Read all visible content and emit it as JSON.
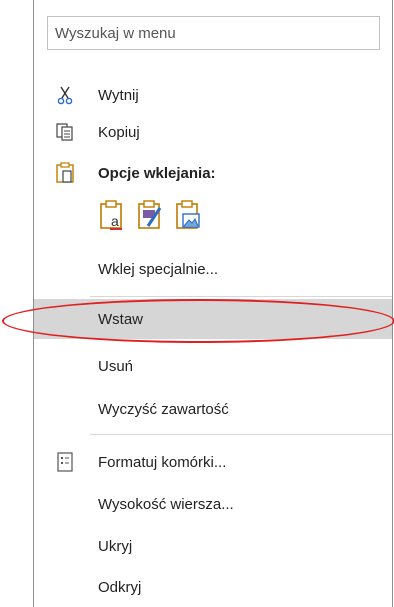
{
  "search": {
    "placeholder": "Wyszukaj w menu"
  },
  "items": {
    "cut": "Wytnij",
    "copy": "Kopiuj",
    "paste_options": "Opcje wklejania:",
    "paste_special": "Wklej specjalnie...",
    "insert": "Wstaw",
    "delete": "Usuń",
    "clear_contents": "Wyczyść zawartość",
    "format_cells": "Formatuj komórki...",
    "row_height": "Wysokość wiersza...",
    "hide": "Ukryj",
    "unhide": "Odkryj"
  },
  "paste_buttons": [
    "paste-values-icon",
    "paste-formatting-icon",
    "paste-picture-icon"
  ],
  "colors": {
    "highlight": "#d6d6d6",
    "annotation": "#e02020",
    "icon_accent": "#c07a00"
  }
}
